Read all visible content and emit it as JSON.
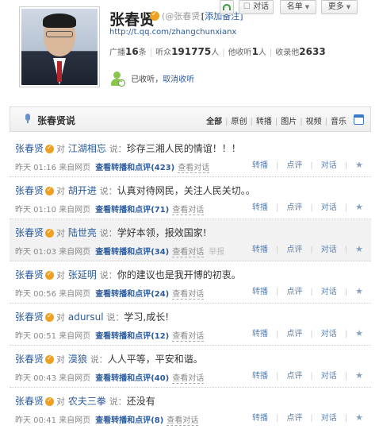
{
  "profile": {
    "name": "张春贤",
    "handle": "(@张春贤)",
    "add_note": "[添加备注]",
    "url": "http://t.qq.com/zhangchunxianx",
    "stats": {
      "broadcast_label": "广播",
      "broadcast_value": "16",
      "broadcast_unit": "条",
      "fans_label": "听众",
      "fans_value": "191775",
      "fans_unit": "人",
      "listens_label": "他收听",
      "listens_value": "1",
      "listens_unit": "人",
      "collected_label": "收录他",
      "collected_value": "2633"
    },
    "listened_text": "已收听",
    "unlisten_link": "取消收听",
    "buttons": {
      "dialog": "对话",
      "list": "名单",
      "more": "更多"
    }
  },
  "feed_header": {
    "title": "张春贤说",
    "filters": [
      "全部",
      "原创",
      "转播",
      "图片",
      "视频",
      "音乐"
    ]
  },
  "item_labels": {
    "to": "对",
    "say": "说：",
    "repost": "查看转播和点评",
    "view_dialog": "查看对话",
    "op_repost": "转播",
    "op_comment": "点评",
    "op_dialog": "对话"
  },
  "feed": [
    {
      "author": "张春贤",
      "target": "江湖相忘",
      "text": "珍存三湘人民的情谊！！！",
      "time": "昨天 01:16",
      "source": "来自网页",
      "count": "(423)",
      "report": ""
    },
    {
      "author": "张春贤",
      "target": "胡开进",
      "text": "认真对待网民，关注人民关切。。",
      "time": "昨天 01:10",
      "source": "来自网页",
      "count": "(71)",
      "report": ""
    },
    {
      "author": "张春贤",
      "target": "陆世亮",
      "text": "学好本领，报效国家!",
      "time": "昨天 01:03",
      "source": "来自网页",
      "count": "(34)",
      "report": "举报"
    },
    {
      "author": "张春贤",
      "target": "张延明",
      "text": "你的建议也是我开博的初衷。",
      "time": "昨天 00:56",
      "source": "来自网页",
      "count": "(24)",
      "report": ""
    },
    {
      "author": "张春贤",
      "target": "adursul",
      "text": "学习,成长!",
      "time": "昨天 00:51",
      "source": "来自网页",
      "count": "(12)",
      "report": ""
    },
    {
      "author": "张春贤",
      "target": "漠狼",
      "text": "人人平等，平安和谐。",
      "time": "昨天 00:43",
      "source": "来自网页",
      "count": "(40)",
      "report": ""
    },
    {
      "author": "张春贤",
      "target": "农夫三拳",
      "text": "还没有",
      "time": "昨天 00:41",
      "source": "来自网页",
      "count": "(8)",
      "report": ""
    }
  ]
}
